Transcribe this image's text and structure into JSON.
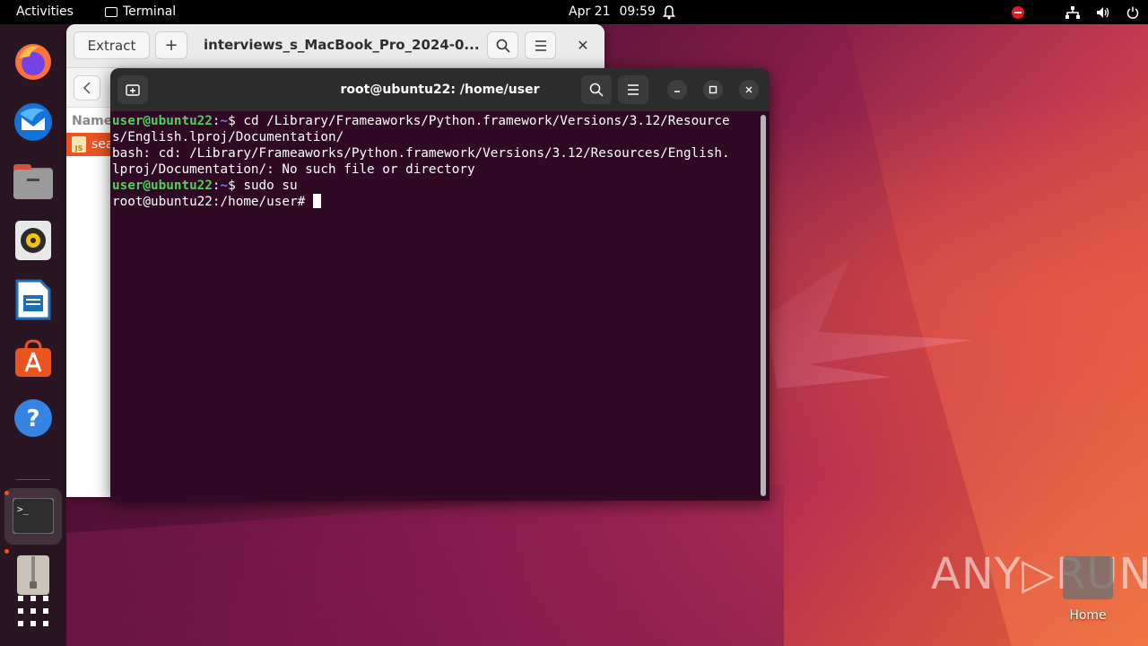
{
  "topbar": {
    "activities": "Activities",
    "app_name": "Terminal",
    "date": "Apr 21",
    "time": "09:59"
  },
  "dock": {
    "items": [
      "firefox-icon",
      "thunderbird-icon",
      "files-icon",
      "rhythmbox-icon",
      "libreoffice-writer-icon",
      "app-center-icon",
      "help-icon",
      "terminal-icon",
      "archive-manager-icon",
      "show-apps-icon"
    ]
  },
  "archive_window": {
    "extract_label": "Extract",
    "plus_label": "+",
    "title": "interviews_s_MacBook_Pro_2024-0...",
    "close_label": "✕",
    "column_name": "Name",
    "file_row": "sea",
    "file_badge": "JS"
  },
  "terminal": {
    "title": "root@ubuntu22: /home/user",
    "lines": {
      "l1_user": "user@ubuntu22",
      "l1_sep": ":",
      "l1_path": "~",
      "l1_cmd": "$ cd /Library/Frameaworks/Python.framework/Versions/3.12/Resource",
      "l2": "s/English.lproj/Documentation/",
      "l3": "bash: cd: /Library/Frameaworks/Python.framework/Versions/3.12/Resources/English.",
      "l4": "lproj/Documentation/: No such file or directory",
      "l5_user": "user@ubuntu22",
      "l5_sep": ":",
      "l5_path": "~",
      "l5_cmd": "$ sudo su",
      "l6": "root@ubuntu22:/home/user# "
    }
  },
  "desktop": {
    "home_label": "Home",
    "watermark": "ANY▷RUN"
  }
}
